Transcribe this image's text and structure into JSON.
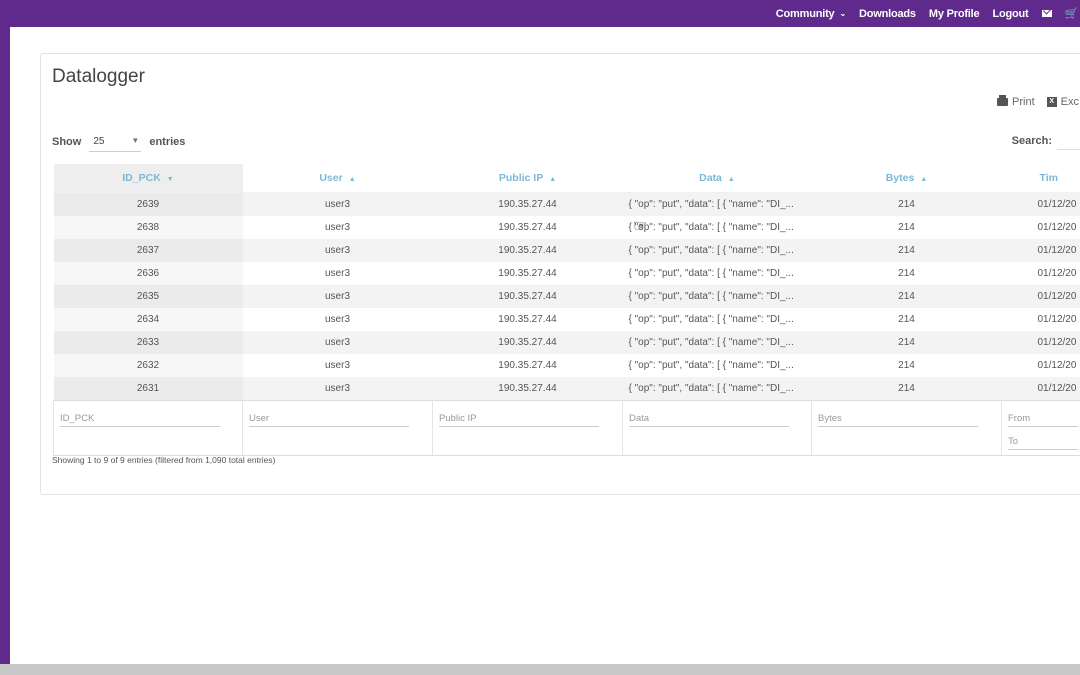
{
  "nav": {
    "community": "Community",
    "downloads": "Downloads",
    "my_profile": "My Profile",
    "logout": "Logout"
  },
  "page": {
    "title": "Datalogger",
    "print_label": "Print",
    "excel_label": "Exc",
    "show_label": "Show",
    "entries_label": "entries",
    "page_length": "25",
    "search_label": "Search:",
    "info": "Showing 1 to 9 of 9 entries (filtered from 1,090 total entries)"
  },
  "table": {
    "headers": [
      "ID_PCK",
      "User",
      "Public IP",
      "Data",
      "Bytes",
      "Tim"
    ],
    "rows": [
      [
        "2639",
        "user3",
        "190.35.27.44",
        "{ \"op\": \"put\", \"data\": [ { \"name\": \"DI_...",
        "214",
        "01/12/20"
      ],
      [
        "2638",
        "user3",
        "190.35.27.44",
        "{ \"op\": \"put\", \"data\": [ { \"name\": \"DI_...",
        "214",
        "01/12/20"
      ],
      [
        "2637",
        "user3",
        "190.35.27.44",
        "{ \"op\": \"put\", \"data\": [ { \"name\": \"DI_...",
        "214",
        "01/12/20"
      ],
      [
        "2636",
        "user3",
        "190.35.27.44",
        "{ \"op\": \"put\", \"data\": [ { \"name\": \"DI_...",
        "214",
        "01/12/20"
      ],
      [
        "2635",
        "user3",
        "190.35.27.44",
        "{ \"op\": \"put\", \"data\": [ { \"name\": \"DI_...",
        "214",
        "01/12/20"
      ],
      [
        "2634",
        "user3",
        "190.35.27.44",
        "{ \"op\": \"put\", \"data\": [ { \"name\": \"DI_...",
        "214",
        "01/12/20"
      ],
      [
        "2633",
        "user3",
        "190.35.27.44",
        "{ \"op\": \"put\", \"data\": [ { \"name\": \"DI_...",
        "214",
        "01/12/20"
      ],
      [
        "2632",
        "user3",
        "190.35.27.44",
        "{ \"op\": \"put\", \"data\": [ { \"name\": \"DI_...",
        "214",
        "01/12/20"
      ],
      [
        "2631",
        "user3",
        "190.35.27.44",
        "{ \"op\": \"put\", \"data\": [ { \"name\": \"DI_...",
        "214",
        "01/12/20"
      ]
    ],
    "filters": {
      "id": "ID_PCK",
      "user": "User",
      "ip": "Public IP",
      "data": "Data",
      "bytes": "Bytes",
      "from": "From",
      "to": "To"
    }
  },
  "colors": {
    "brand": "#5f2a8c",
    "header_text": "#7db8d6"
  }
}
